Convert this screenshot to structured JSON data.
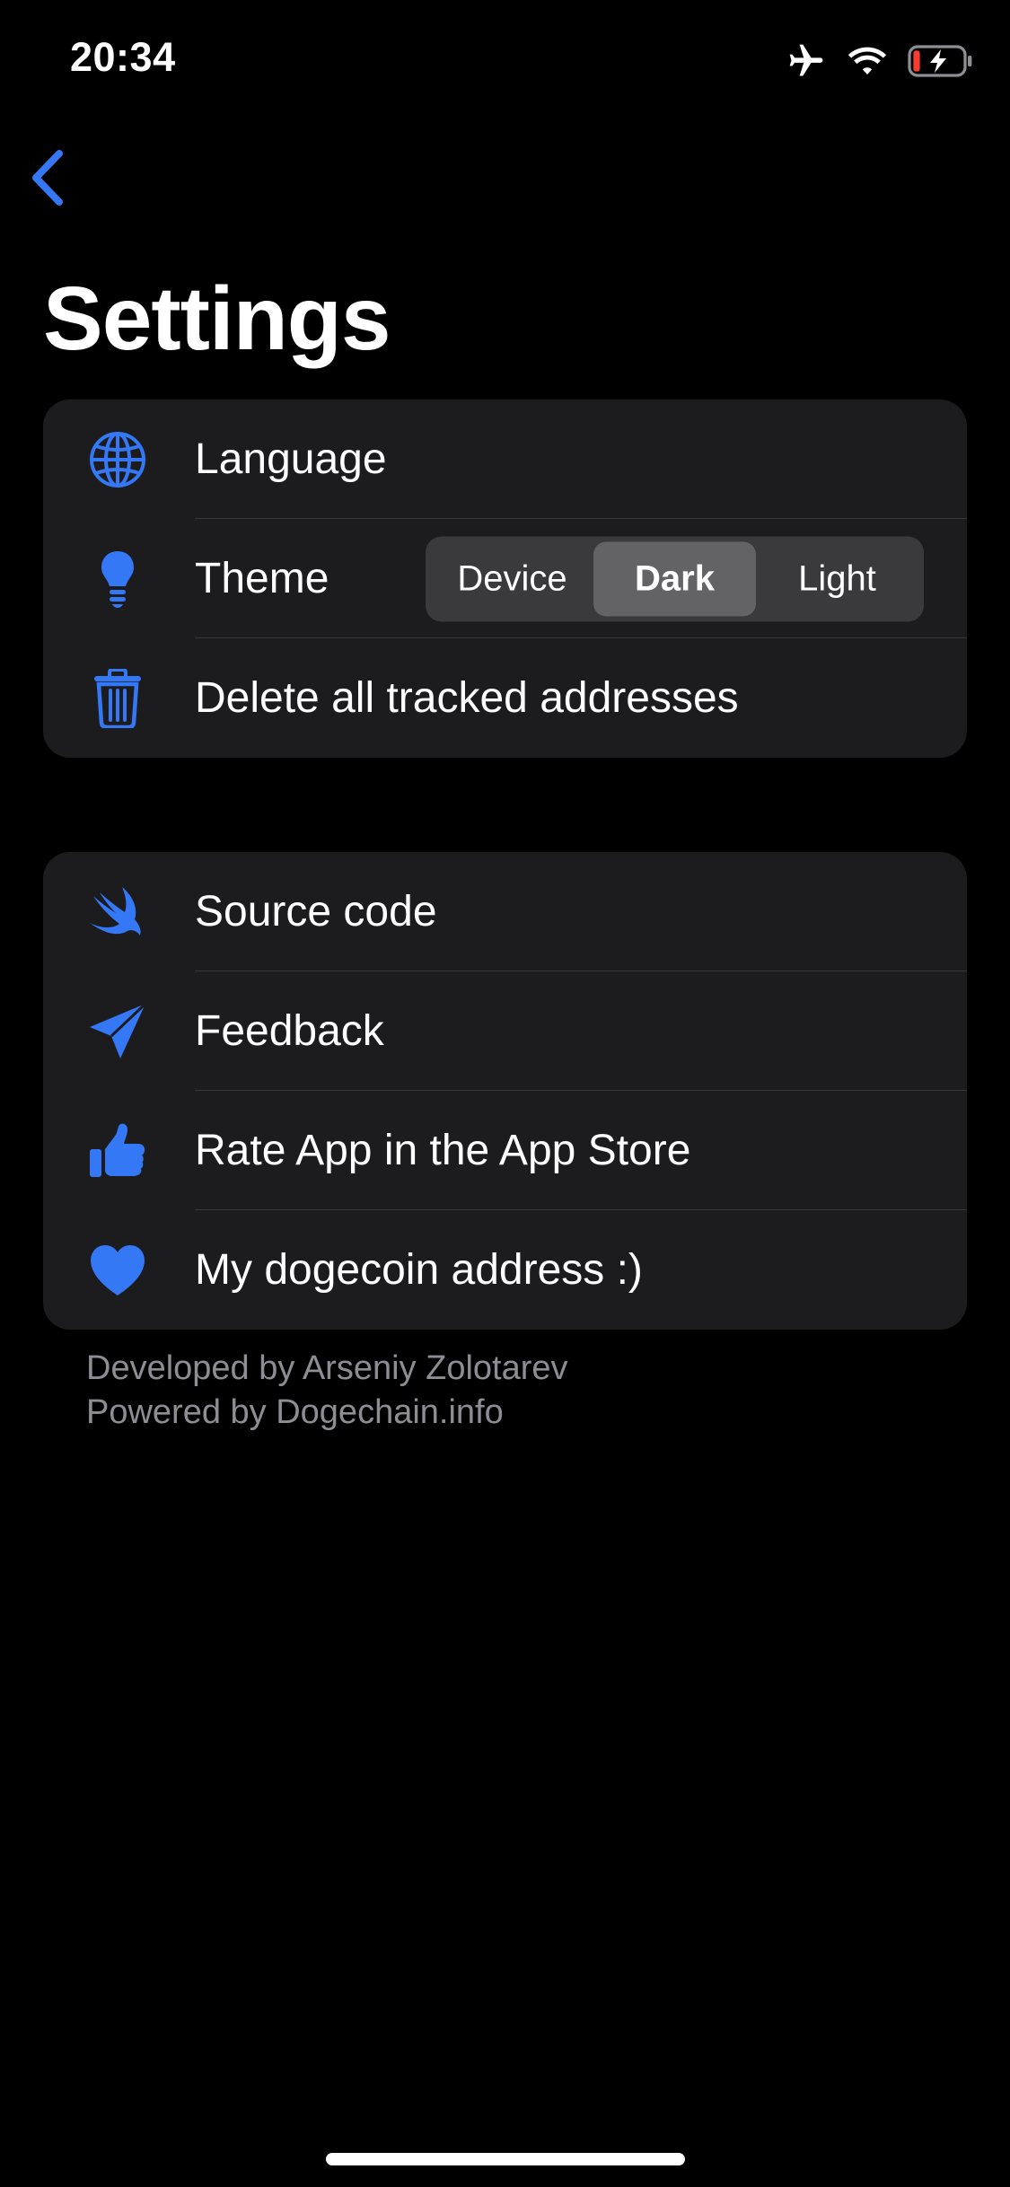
{
  "status_bar": {
    "time": "20:34",
    "icons": [
      "airplane-icon",
      "wifi-icon",
      "battery-charging-icon"
    ]
  },
  "nav": {
    "back_icon": "chevron-left-icon"
  },
  "page_title": "Settings",
  "colors": {
    "accent": "#3478f6",
    "background": "#000000",
    "group_background": "#1c1c1e",
    "separator": "#38383a",
    "segment_track": "#3a3a3c",
    "segment_active": "#636366",
    "footer_text": "#8d8d93",
    "battery_low": "#ff3b30"
  },
  "group1": {
    "language": {
      "label": "Language",
      "icon": "globe-icon"
    },
    "theme": {
      "label": "Theme",
      "icon": "lightbulb-icon",
      "options": [
        "Device",
        "Dark",
        "Light"
      ],
      "selected": "Dark"
    },
    "delete": {
      "label": "Delete all tracked addresses",
      "icon": "trash-icon"
    }
  },
  "group2": {
    "source_code": {
      "label": "Source code",
      "icon": "swift-icon"
    },
    "feedback": {
      "label": "Feedback",
      "icon": "paperplane-icon"
    },
    "rate_app": {
      "label": "Rate App in the App Store",
      "icon": "thumbs-up-icon"
    },
    "dogecoin": {
      "label": "My dogecoin address :)",
      "icon": "heart-icon"
    }
  },
  "footer": {
    "line1": "Developed by Arseniy Zolotarev",
    "line2": "Powered by Dogechain.info"
  }
}
